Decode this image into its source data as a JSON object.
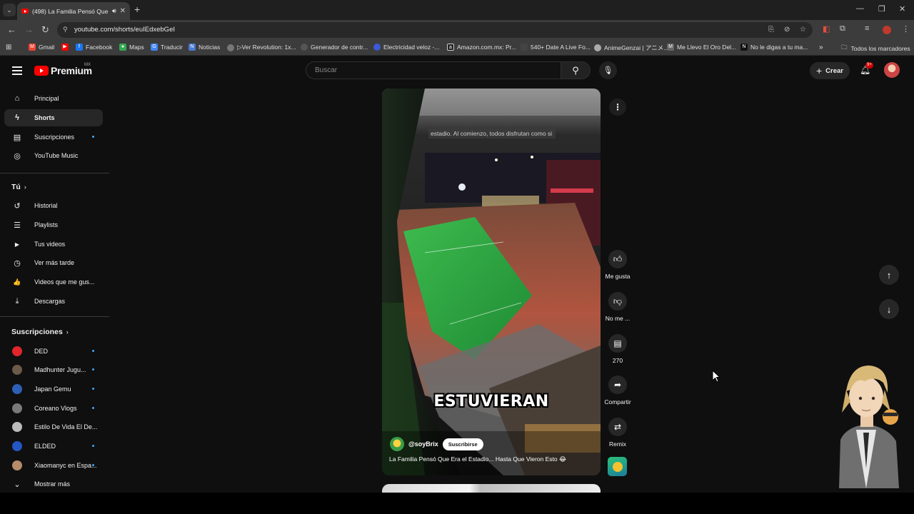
{
  "browser": {
    "tab_title": "(498) La Familia Pensó Que Era el Estadio... Hasta Que Vieron Esto",
    "url": "youtube.com/shorts/euIEdxebGeI",
    "bookmarks": [
      {
        "label": "Gmail",
        "icon_color": "#ea4335"
      },
      {
        "label": "",
        "icon_color": "#ff0000"
      },
      {
        "label": "Facebook",
        "icon_color": "#1877f2"
      },
      {
        "label": "Maps",
        "icon_color": "#34a853"
      },
      {
        "label": "Traducir",
        "icon_color": "#4285f4"
      },
      {
        "label": "Noticias",
        "icon_color": "#4a7bd0"
      },
      {
        "label": "▷Ver Revolution: 1x...",
        "icon_color": "#777777"
      },
      {
        "label": "Generador de contr...",
        "icon_color": "#555555"
      },
      {
        "label": "Electricidad veloz -...",
        "icon_color": "#3b5ad6"
      },
      {
        "label": "Amazon.com.mx: Pr...",
        "icon_color": "#222222"
      },
      {
        "label": "540+ Date A Live Fo...",
        "icon_color": "#444444"
      },
      {
        "label": "AnimeGenzai | アニメ...",
        "icon_color": "#aaaaaa"
      },
      {
        "label": "Me Llevo El Oro Del...",
        "icon_color": "#666666"
      },
      {
        "label": "No le digas a tu ma...",
        "icon_color": "#111111"
      }
    ],
    "more_bookmarks": "»",
    "all_bookmarks": "Todos los marcadores"
  },
  "header": {
    "logo_text": "Premium",
    "region": "MX",
    "search_placeholder": "Buscar",
    "create_label": "Crear",
    "notif_badge": "9+"
  },
  "sidebar": {
    "main": [
      {
        "label": "Principal",
        "icon": "home-icon",
        "glyph": "⌂"
      },
      {
        "label": "Shorts",
        "icon": "shorts-icon",
        "glyph": "ϟ"
      },
      {
        "label": "Suscripciones",
        "icon": "subscriptions-icon",
        "glyph": "▤"
      },
      {
        "label": "YouTube Music",
        "icon": "music-icon",
        "glyph": "◎"
      }
    ],
    "you_heading": "Tú",
    "you": [
      {
        "label": "Historial",
        "icon": "history-icon",
        "glyph": "↺"
      },
      {
        "label": "Playlists",
        "icon": "playlists-icon",
        "glyph": "☰"
      },
      {
        "label": "Tus videos",
        "icon": "your-videos-icon",
        "glyph": "▶"
      },
      {
        "label": "Ver más tarde",
        "icon": "watch-later-icon",
        "glyph": "◷"
      },
      {
        "label": "Videos que me gus...",
        "icon": "liked-icon",
        "glyph": "👍"
      },
      {
        "label": "Descargas",
        "icon": "downloads-icon",
        "glyph": "⤓"
      }
    ],
    "subs_heading": "Suscripciones",
    "subs": [
      {
        "label": "DED",
        "color": "#e0262b"
      },
      {
        "label": "Madhunter Jugu...",
        "color": "#6b5a4a"
      },
      {
        "label": "Japan Gemu",
        "color": "#2d5fb5"
      },
      {
        "label": "Coreano Vlogs",
        "color": "#7a7a7a"
      },
      {
        "label": "Estilo De Vida El De...",
        "color": "#bbbbbb"
      },
      {
        "label": "ELDED",
        "color": "#2457c5"
      },
      {
        "label": "Xiaomanyc en Espa...",
        "color": "#b78c6b"
      }
    ],
    "show_more": "Mostrar más"
  },
  "short": {
    "caption_small": "estadio. Al comienzo, todos disfrutan como si",
    "caption_big": "ESTUVIERAN",
    "channel": "@soyBrix",
    "subscribe_label": "Suscribirse",
    "title": "La Familia Pensó Que Era el Estadio... Hasta Que Vieron Esto 😂"
  },
  "actions": {
    "like": "Me gusta",
    "dislike": "No me ...",
    "comments": "270",
    "share": "Compartir",
    "remix": "Remix"
  }
}
